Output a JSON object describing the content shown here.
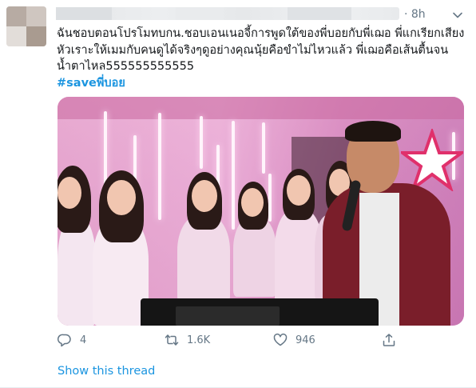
{
  "tweet": {
    "timestamp": "· 8h",
    "text_lines": [
      "ฉันชอบตอนโปรโมทบกน.ชอบเอนเนอจี้การพูดใต้ของพี่บอยกับพี่เฌอ พี่แกเรียกเสียง",
      "หัวเราะให้เมมกับคนดูได้จริงๆดูอย่างคุณนุ้ยคือขำไม่ไหวแล้ว พี่เฌอคือเส้นตื้นจน",
      "น้ำตาไหล555555555555"
    ],
    "hashtag": "#saveพี่บอย",
    "actions": {
      "reply_count": "4",
      "retweet_count": "1.6K",
      "like_count": "946"
    },
    "show_thread": "Show this thread"
  },
  "icons": {
    "caret": "chevron-down-icon",
    "reply": "reply-icon",
    "retweet": "retweet-icon",
    "like": "heart-icon",
    "share": "share-icon"
  },
  "colors": {
    "text_primary": "#14171a",
    "text_secondary": "#657786",
    "link": "#1b95e0"
  }
}
